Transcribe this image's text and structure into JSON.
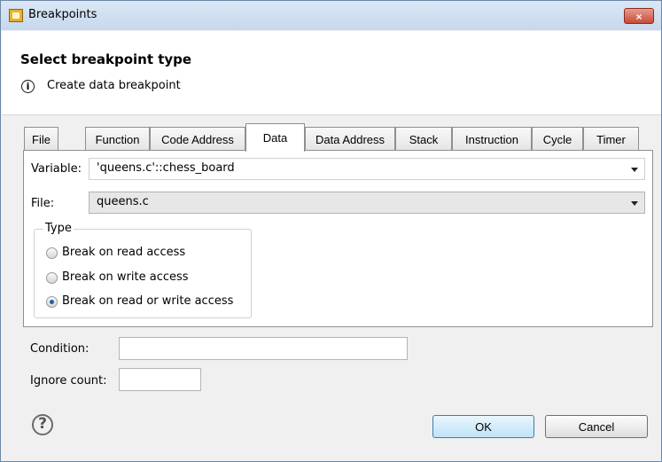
{
  "window": {
    "title": "Breakpoints",
    "close_label": "×"
  },
  "header": {
    "heading": "Select breakpoint type",
    "info_icon": "i",
    "info_text": "Create data breakpoint"
  },
  "tabs": [
    {
      "label": "File"
    },
    {
      "label": "Function"
    },
    {
      "label": "Code Address"
    },
    {
      "label": "Data"
    },
    {
      "label": "Data Address"
    },
    {
      "label": "Stack"
    },
    {
      "label": "Instruction"
    },
    {
      "label": "Cycle"
    },
    {
      "label": "Timer"
    }
  ],
  "data_tab": {
    "variable_label": "Variable:",
    "variable_value": "'queens.c'::chess_board",
    "file_label": "File:",
    "file_value": "queens.c",
    "type_group": {
      "title": "Type",
      "options": [
        {
          "label": "Break on read access",
          "checked": false
        },
        {
          "label": "Break on write access",
          "checked": false
        },
        {
          "label": "Break on read or write access",
          "checked": true
        }
      ]
    }
  },
  "form": {
    "condition_label": "Condition:",
    "condition_value": "",
    "ignore_count_label": "Ignore count:",
    "ignore_count_value": ""
  },
  "footer": {
    "help_icon": "?",
    "ok_label": "OK",
    "cancel_label": "Cancel"
  }
}
